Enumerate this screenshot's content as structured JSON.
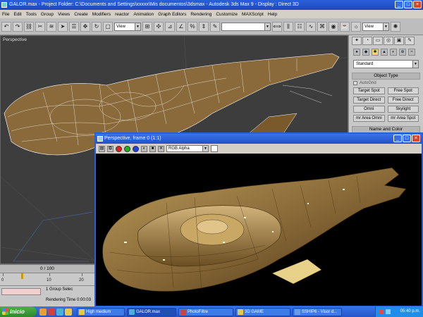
{
  "window": {
    "title": "GALOR.max   - Project Folder: C:\\Documents and Settings\\xxxxx\\Mis documentos\\3dsmax    - Autodesk 3ds Max 9      - Display : Direct 3D",
    "minimize_glyph": "_",
    "maximize_glyph": "□",
    "close_glyph": "×"
  },
  "menu": [
    "File",
    "Edit",
    "Tools",
    "Group",
    "Views",
    "Create",
    "Modifiers",
    "reactor",
    "Animation",
    "Graph Editors",
    "Rendering",
    "Customize",
    "MAXScript",
    "Help"
  ],
  "toolbar": {
    "view_select": "View",
    "view_select2": "View",
    "icons": [
      "undo-icon",
      "redo-icon",
      "link-icon",
      "unlink-icon",
      "bind-icon",
      "select-icon",
      "select-name-icon",
      "move-icon",
      "rotate-icon",
      "scale-icon",
      "snap-icon",
      "angle-snap-icon",
      "percent-snap-icon",
      "spinner-snap-icon",
      "mirror-icon",
      "align-icon",
      "layer-icon",
      "curve-editor-icon",
      "schematic-icon",
      "material-icon",
      "render-setup-icon",
      "quick-render-icon"
    ]
  },
  "viewport": {
    "label": "Perspective"
  },
  "command_panel": {
    "tab_glyphs": [
      "✦",
      "◔",
      "▭",
      "◎",
      "▣",
      "✎"
    ],
    "icon_glyphs": [
      "●",
      "◆",
      "✱",
      "▲",
      "◐",
      "⊕",
      "≈"
    ],
    "category": "Standard",
    "rollout_object_type": "Object Type",
    "autogrid_label": "AutoGrid",
    "buttons": [
      "Target Spot",
      "Free Spot",
      "Target Direct",
      "Free Direct",
      "Omni",
      "Skylight",
      "mr Area Omni",
      "mr Area Spot"
    ],
    "rollout_name_color": "Name and Color"
  },
  "render_window": {
    "title": "Perspective, frame 0 (1:1)",
    "channel": "RGB Alpha",
    "colors": {
      "red": "#e02020",
      "green": "#20b020",
      "blue": "#2040e0"
    }
  },
  "timeline": {
    "frame_display": "0 / 100",
    "ticks": [
      "0",
      "10",
      "20"
    ]
  },
  "status": {
    "selection": "1 Group Selec",
    "render_time": "Rendering Time  0:00:03"
  },
  "taskbar": {
    "start_label": "Inicio",
    "tasks": [
      "High medium",
      "GALOR.max",
      "PhotoFiltre",
      "3D GAME",
      "SSHIP6 - Visor d...",
      "Perspective, fra..."
    ],
    "task_colors": [
      "#e8c84a",
      "#4ab0d8",
      "#d04040",
      "#e8c84a",
      "#6b9ae8",
      "#4ab0d8"
    ],
    "clock": "05:40 p.m."
  }
}
